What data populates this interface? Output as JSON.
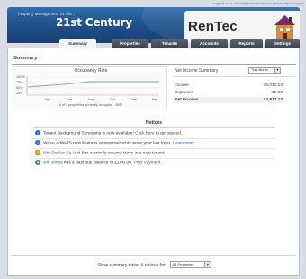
{
  "topbar": {
    "logged_in_prefix": "Logged in as: ",
    "user_email": "demo@rentecdirect.com",
    "separator_1": " | ",
    "help_link": "need help?",
    "separator_2": " | ",
    "logout_link": "logout"
  },
  "header": {
    "tagline": "Property Management for the ...",
    "product_name": "21st Century",
    "logo_text": "RenTec"
  },
  "tabs": [
    {
      "label": "Summary",
      "active": true
    },
    {
      "label": "Properties",
      "active": false
    },
    {
      "label": "Tenants",
      "active": false
    },
    {
      "label": "Accounts",
      "active": false
    },
    {
      "label": "Reports",
      "active": false
    },
    {
      "label": "Settings",
      "active": false
    }
  ],
  "summary": {
    "title": "Summary",
    "occupancy": {
      "title": "Occupancy Rate",
      "caption": "4 of 5 properties currently occupied - 80%",
      "y_ticks": [
        "100%",
        "75%",
        "50%",
        "25%"
      ],
      "x_ticks": [
        "Apr",
        "Jun",
        "Aug",
        "Oct",
        "Dec",
        "Feb"
      ]
    },
    "net_income": {
      "title": "Net Income Summary",
      "period": "This Month",
      "rows": [
        {
          "label": "Income",
          "value": "15,012.13"
        },
        {
          "label": "Expenses",
          "value": "35.00"
        }
      ],
      "total": {
        "label": "Net Income",
        "value": "14,977.13"
      }
    }
  },
  "notices": {
    "title": "Notices",
    "items": [
      {
        "icon": "info-icon",
        "color": "#2b65c4",
        "text": "Tenant Background Screening is now available!",
        "link": "Click here",
        "suffix": " to get started."
      },
      {
        "icon": "info-icon",
        "color": "#2b65c4",
        "text": "We've added 5 new features or improvements since your last login.",
        "link": "Learn more",
        "suffix": ""
      },
      {
        "icon": "warning-icon",
        "color": "#e0a21b",
        "text_link": "989 Duplex St, Unit B",
        "text": " is currently vacant.",
        "link": "Move in",
        "suffix": " a new tenant."
      },
      {
        "icon": "money-icon",
        "color": "#3a9a3a",
        "text_link": "Jim Jones",
        "text": " has a past due balance of 1,000.00.",
        "link": "Post Payment",
        "suffix": ""
      }
    ]
  },
  "footer": {
    "label": "Show summary report & notices for:",
    "selected": "All Properties"
  }
}
